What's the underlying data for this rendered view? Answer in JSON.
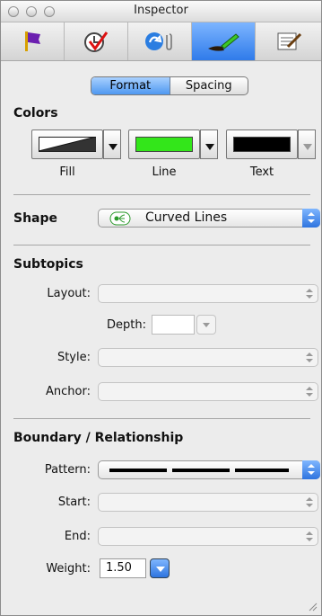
{
  "window": {
    "title": "Inspector"
  },
  "toolbar": {
    "icons": [
      "flag-icon",
      "clock-check-icon",
      "link-attachment-icon",
      "brush-icon",
      "notes-icon"
    ],
    "selected": "brush-icon"
  },
  "tabs": {
    "format": "Format",
    "spacing": "Spacing",
    "selected": "Format"
  },
  "colors": {
    "title": "Colors",
    "fill_label": "Fill",
    "line_label": "Line",
    "text_label": "Text",
    "line_color": "#33e61a",
    "text_color": "#000000"
  },
  "shape": {
    "label": "Shape",
    "value": "Curved Lines"
  },
  "subtopics": {
    "title": "Subtopics",
    "layout_label": "Layout:",
    "depth_label": "Depth:",
    "style_label": "Style:",
    "anchor_label": "Anchor:"
  },
  "boundary": {
    "title": "Boundary / Relationship",
    "pattern_label": "Pattern:",
    "start_label": "Start:",
    "end_label": "End:",
    "weight_label": "Weight:",
    "weight_value": "1.50"
  },
  "accent": "#2f7bea"
}
